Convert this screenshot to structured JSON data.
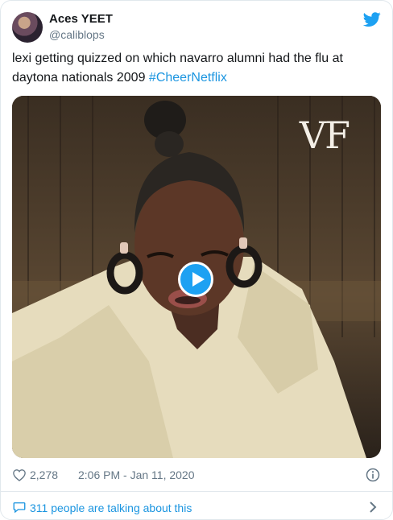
{
  "user": {
    "name": "Aces YEET",
    "handle": "@caliblops"
  },
  "tweet": {
    "text": "lexi getting quizzed on which navarro alumni had the flu at daytona nationals 2009 ",
    "hashtag": "#CheerNetflix"
  },
  "media": {
    "watermark": "VF",
    "type": "video"
  },
  "meta": {
    "likes": "2,278",
    "timestamp": "2:06 PM - Jan 11, 2020"
  },
  "footer": {
    "talking": "311 people are talking about this"
  },
  "colors": {
    "accent": "#1da1f2",
    "link": "#1b95e0",
    "muted": "#657786",
    "border": "#e1e8ed"
  },
  "icons": [
    "twitter-bird-icon",
    "heart-icon",
    "info-icon",
    "comment-bubble-icon",
    "chevron-right-icon",
    "play-icon"
  ]
}
